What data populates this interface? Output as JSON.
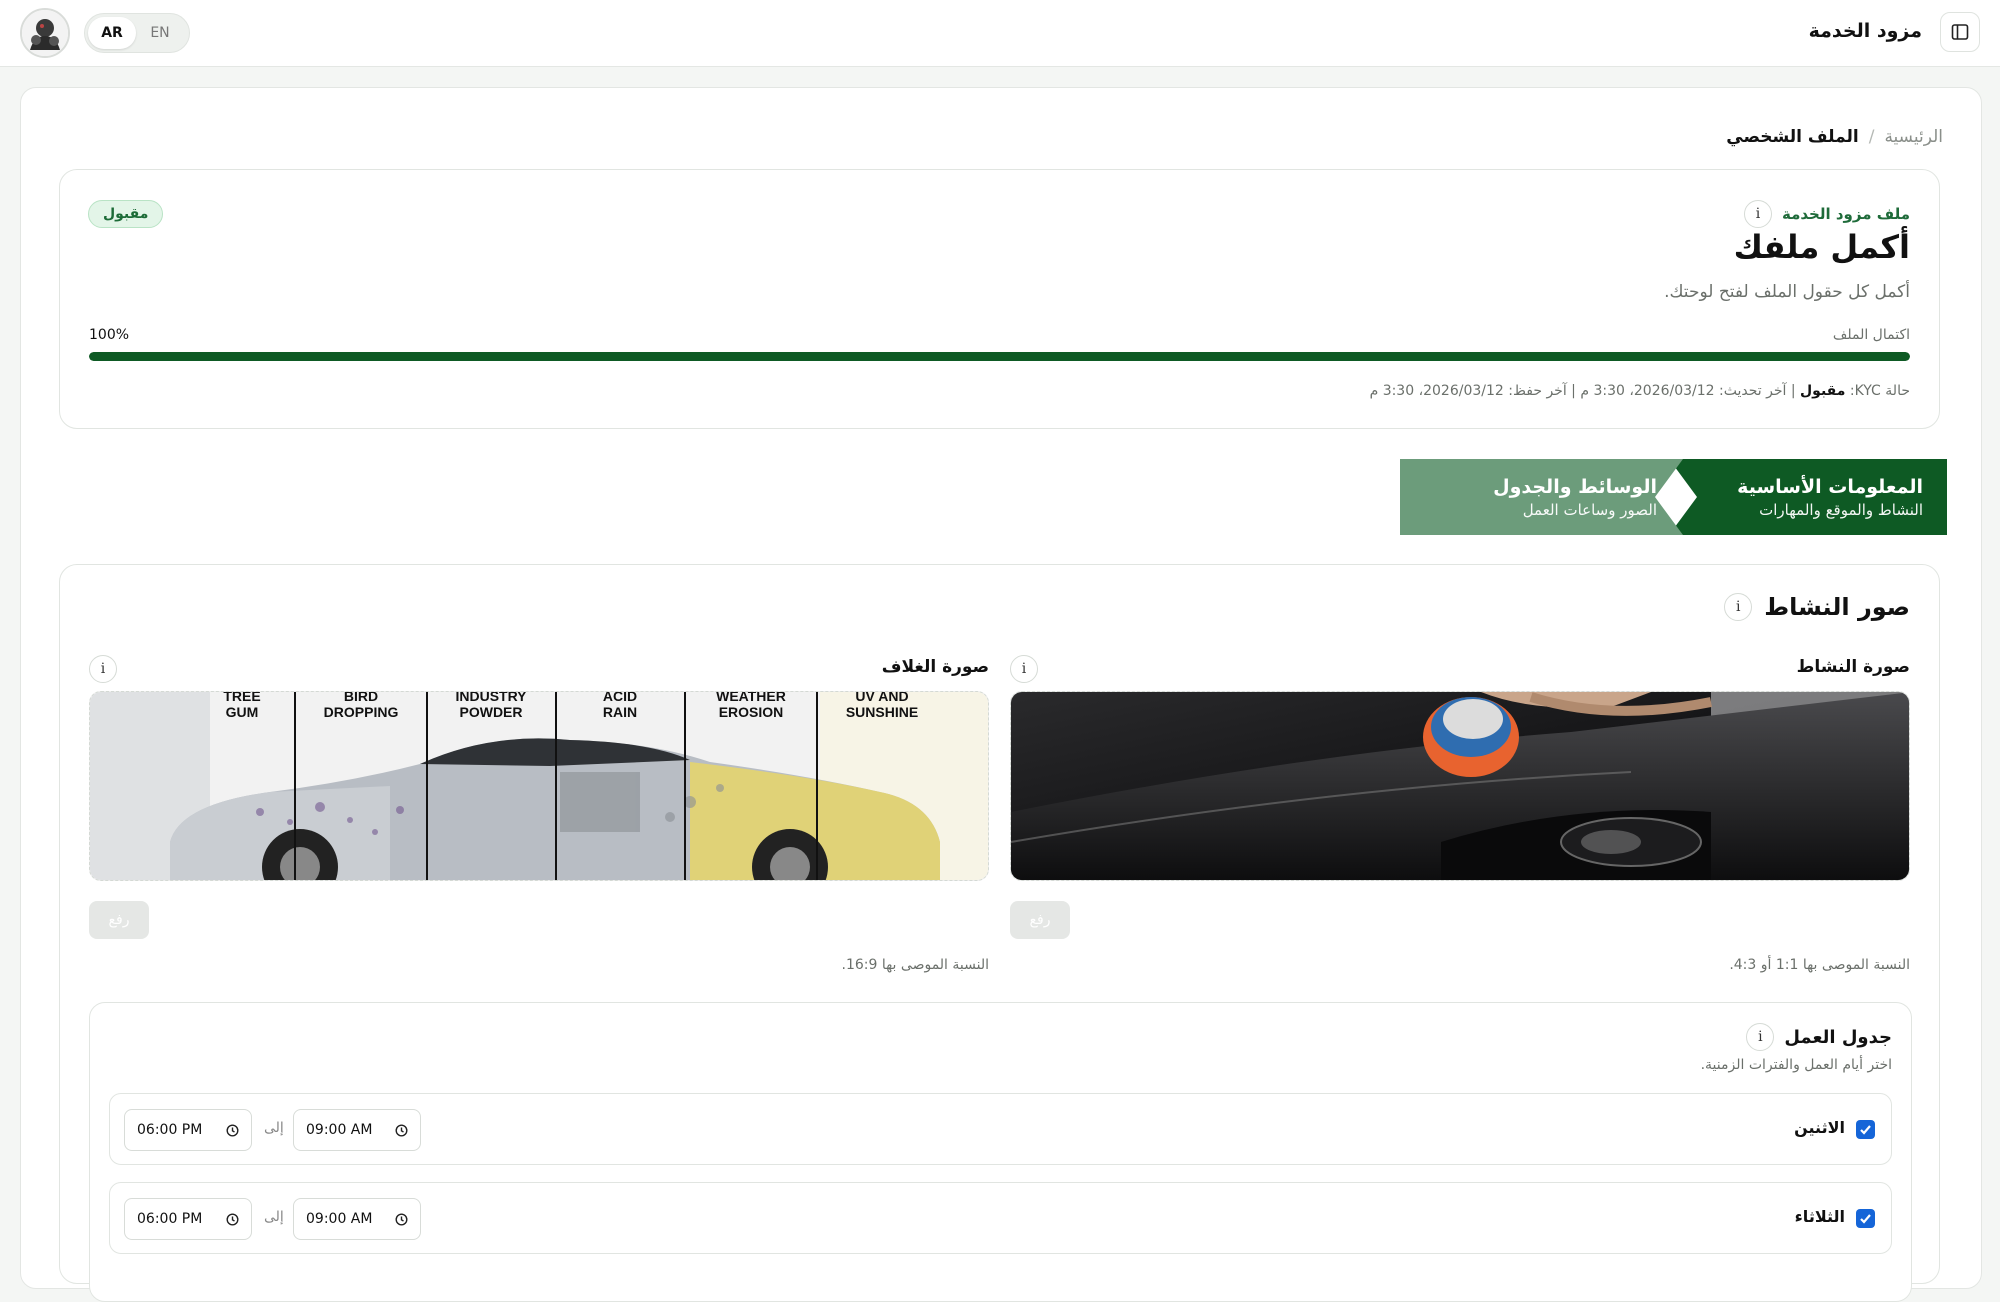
{
  "header": {
    "title": "مزود الخدمة",
    "languages": [
      "AR",
      "EN"
    ],
    "active_language": "AR"
  },
  "breadcrumb": {
    "home": "الرئيسية",
    "separator": "/",
    "current": "الملف الشخصي"
  },
  "profile": {
    "label": "ملف مزود الخدمة",
    "title": "أكمل ملفك",
    "subtitle": "أكمل كل حقول الملف لفتح لوحتك.",
    "status_badge": "مقبول",
    "progress_label": "اكتمال الملف",
    "progress_percent_text": "100%",
    "progress_value": 100,
    "kyc": {
      "prefix": "حالة KYC:",
      "status": "مقبول",
      "rest": "| آخر تحديث: 2026/03/12، 3:30 م | آخر حفظ: 2026/03/12، 3:30 م"
    }
  },
  "steps": [
    {
      "title": "المعلومات الأساسية",
      "subtitle": "النشاط والموقع والمهارات",
      "active": true
    },
    {
      "title": "الوسائط والجدول",
      "subtitle": "الصور وساعات العمل",
      "active": false
    }
  ],
  "photos": {
    "section_title": "صور النشاط",
    "activity": {
      "label": "صورة النشاط",
      "upload": "رفع",
      "hint": "النسبة الموصى بها 1:1 أو 4:3."
    },
    "cover": {
      "label": "صورة الغلاف",
      "upload": "رفع",
      "hint": "النسبة الموصى بها 16:9.",
      "panels": [
        [
          "UV AND",
          "SUNSHINE"
        ],
        [
          "WEATHER",
          "EROSION"
        ],
        [
          "ACID",
          "RAIN"
        ],
        [
          "INDUSTRY",
          "POWDER"
        ],
        [
          "BIRD",
          "DROPPING"
        ],
        [
          "TREE",
          "GUM"
        ]
      ]
    }
  },
  "schedule": {
    "title": "جدول العمل",
    "subtitle": "اختر أيام العمل والفترات الزمنية.",
    "to_label": "إلى",
    "days": [
      {
        "name": "الاثنين",
        "checked": true,
        "from": "09:00 AM",
        "to": "06:00 PM"
      },
      {
        "name": "الثلاثاء",
        "checked": true,
        "from": "09:00 AM",
        "to": "06:00 PM"
      }
    ]
  },
  "colors": {
    "brand_dark": "#0e5a24",
    "brand_light": "#6c9c7b",
    "badge_bg": "#e3f5e8",
    "checkbox": "#1565d8"
  },
  "icons": {
    "sidebar_toggle": "sidebar-toggle-icon",
    "info": "info-icon",
    "clock": "clock-icon",
    "check": "check-icon"
  }
}
